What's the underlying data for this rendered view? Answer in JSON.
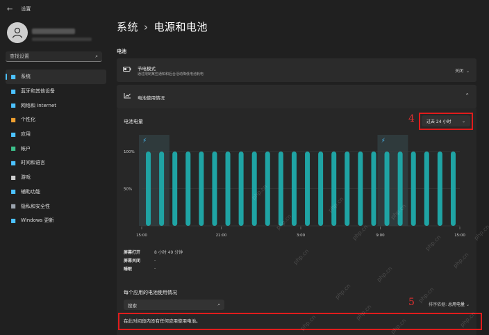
{
  "window": {
    "title": "设置",
    "back_icon": "back-arrow-icon"
  },
  "sidebar": {
    "search_placeholder": "查找设置",
    "items": [
      {
        "label": "系统",
        "icon": "monitor-icon",
        "color": "#4cc2ff",
        "active": true
      },
      {
        "label": "蓝牙和其他设备",
        "icon": "bluetooth-icon",
        "color": "#4cc2ff"
      },
      {
        "label": "网络和 Internet",
        "icon": "wifi-icon",
        "color": "#4cc2ff"
      },
      {
        "label": "个性化",
        "icon": "brush-icon",
        "color": "#f0a030"
      },
      {
        "label": "应用",
        "icon": "apps-icon",
        "color": "#4cc2ff"
      },
      {
        "label": "帐户",
        "icon": "account-icon",
        "color": "#3cc08a"
      },
      {
        "label": "时间和语言",
        "icon": "clock-globe-icon",
        "color": "#4cc2ff"
      },
      {
        "label": "游戏",
        "icon": "gamepad-icon",
        "color": "#cccccc"
      },
      {
        "label": "辅助功能",
        "icon": "accessibility-icon",
        "color": "#4cc2ff"
      },
      {
        "label": "隐私和安全性",
        "icon": "shield-icon",
        "color": "#9aa3ad"
      },
      {
        "label": "Windows 更新",
        "icon": "update-icon",
        "color": "#4cc2ff"
      }
    ]
  },
  "header": {
    "breadcrumb_parent": "系统",
    "breadcrumb_sep": "›",
    "breadcrumb_current": "电源和电池"
  },
  "battery_section": {
    "label": "电池"
  },
  "saver": {
    "title": "节电模式",
    "subtitle": "通过限制某些通知和后台活动降低电池耗电",
    "value": "关闭"
  },
  "usage": {
    "title": "电池使用情况"
  },
  "chart_panel": {
    "title": "电池电量",
    "annotation_4": "4",
    "annotation_5": "5",
    "range_select": "过去 24 小时",
    "stats": [
      {
        "key": "屏幕打开",
        "value": "8 小时 49 分钟"
      },
      {
        "key": "屏幕关闭",
        "value": "-"
      },
      {
        "key": "睡眠",
        "value": "-"
      }
    ],
    "per_app_title": "每个应用的电池使用情况",
    "app_search_placeholder": "搜索",
    "sort_label": "排序依据:",
    "sort_value": "总用电量",
    "empty_message": "在此时间段内没有任何应用使用电池。"
  },
  "watermark": "php.cn",
  "chart_data": {
    "type": "bar",
    "categories": [
      "15:00",
      "16:00",
      "17:00",
      "18:00",
      "19:00",
      "20:00",
      "21:00",
      "22:00",
      "23:00",
      "0:00",
      "1:00",
      "2:00",
      "3:00",
      "4:00",
      "5:00",
      "6:00",
      "7:00",
      "8:00",
      "9:00",
      "10:00",
      "11:00",
      "12:00",
      "13:00",
      "14:00"
    ],
    "values": [
      100,
      100,
      100,
      100,
      100,
      100,
      100,
      100,
      100,
      100,
      100,
      100,
      100,
      100,
      100,
      100,
      100,
      100,
      100,
      100,
      100,
      100,
      100,
      100
    ],
    "ytick_labels": [
      "100%",
      "50%"
    ],
    "xtick_labels": [
      "15:00",
      "21:00",
      "3:00",
      "9:00",
      "15:00"
    ],
    "ylim": [
      0,
      100
    ],
    "charging_hours": [
      "15:00",
      "9:00"
    ],
    "bar_color": "#1fa4a4",
    "grid": true
  }
}
